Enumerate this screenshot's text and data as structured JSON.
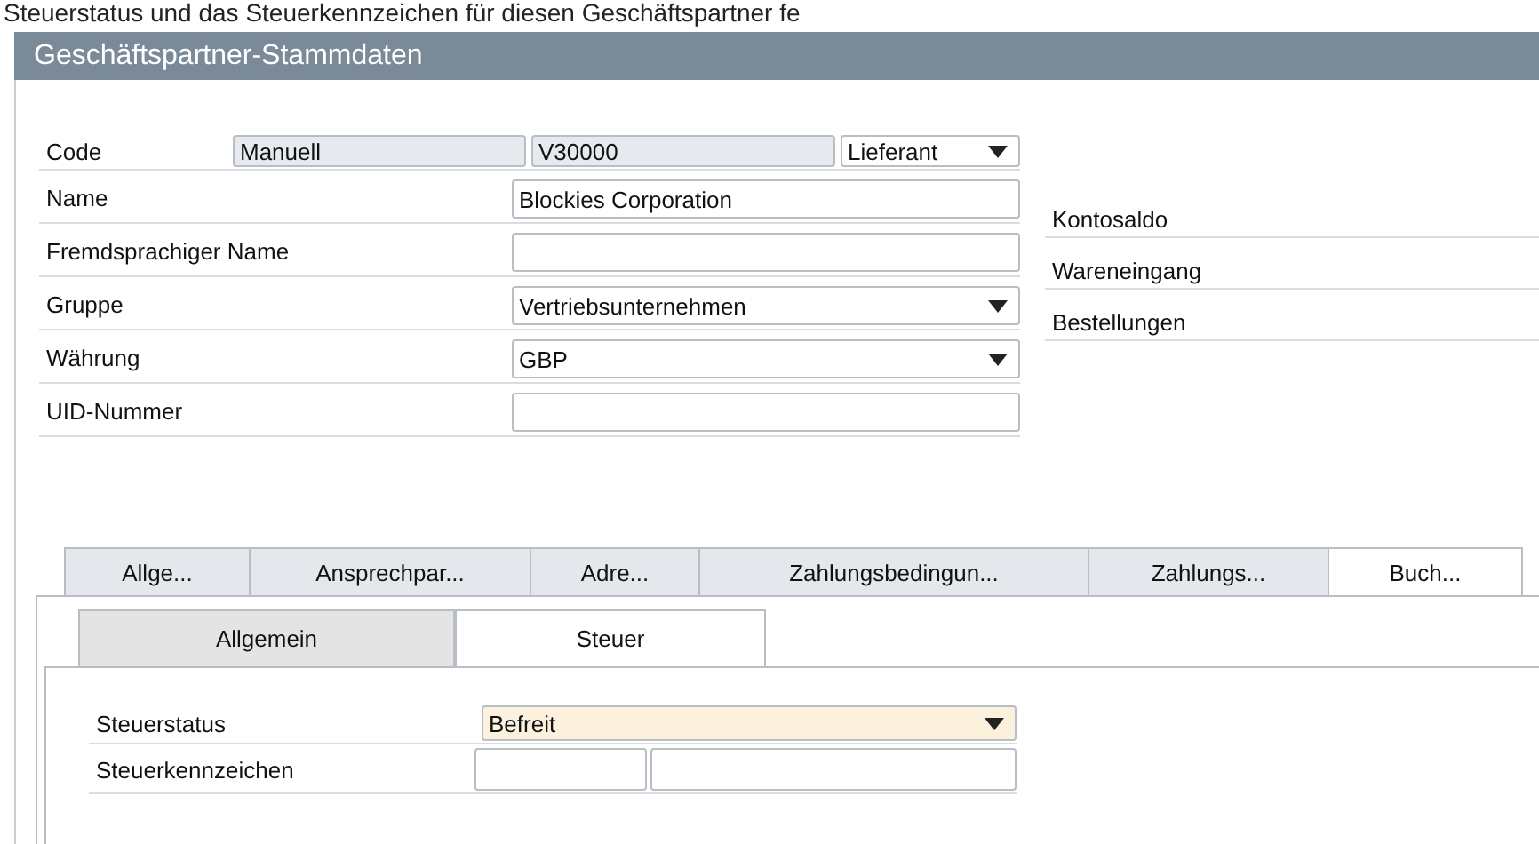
{
  "caption": "Steuerstatus und das Steuerkennzeichen für diesen Geschäftspartner fe",
  "window": {
    "title": "Geschäftspartner-Stammdaten"
  },
  "header_rows": [
    {
      "kind": "code",
      "label": "Code",
      "controls": [
        {
          "kind": "readonly",
          "value": "Manuell"
        },
        {
          "kind": "readonly",
          "value": "V30000"
        },
        {
          "kind": "dropdown",
          "value": "Lieferant"
        }
      ]
    },
    {
      "kind": "field",
      "label": "Name",
      "controls": [
        {
          "kind": "text",
          "value": "Blockies Corporation"
        }
      ]
    },
    {
      "kind": "field",
      "label": "Fremdsprachiger Name",
      "controls": [
        {
          "kind": "text"
        }
      ]
    },
    {
      "kind": "field",
      "label": "Gruppe",
      "controls": [
        {
          "kind": "dropdown",
          "value": "Vertriebsunternehmen"
        }
      ]
    },
    {
      "kind": "field",
      "label": "Währung",
      "controls": [
        {
          "kind": "dropdown",
          "value": "GBP"
        }
      ]
    },
    {
      "kind": "field",
      "label": "UID-Nummer",
      "controls": [
        {
          "kind": "text"
        }
      ]
    }
  ],
  "summary_labels": [
    "Kontosaldo",
    "Wareneingang",
    "Bestellungen"
  ],
  "tabs": [
    {
      "label": "Allge...",
      "selected": false
    },
    {
      "label": "Ansprechpar...",
      "selected": false
    },
    {
      "label": "Adre...",
      "selected": false
    },
    {
      "label": "Zahlungsbedingun...",
      "selected": false
    },
    {
      "label": "Zahlungs...",
      "selected": false
    },
    {
      "label": "Buch...",
      "selected": true
    }
  ],
  "sub_tabs": [
    {
      "label": "Allgemein",
      "selected": false
    },
    {
      "label": "Steuer",
      "selected": true
    }
  ],
  "tax_rows": [
    {
      "label": "Steuerstatus",
      "controls": [
        {
          "kind": "dropdown",
          "value": "Befreit",
          "focused": true
        }
      ]
    },
    {
      "label": "Steuerkennzeichen",
      "controls": [
        {
          "kind": "text",
          "focused": false
        },
        {
          "kind": "text",
          "focused": false
        }
      ]
    }
  ]
}
